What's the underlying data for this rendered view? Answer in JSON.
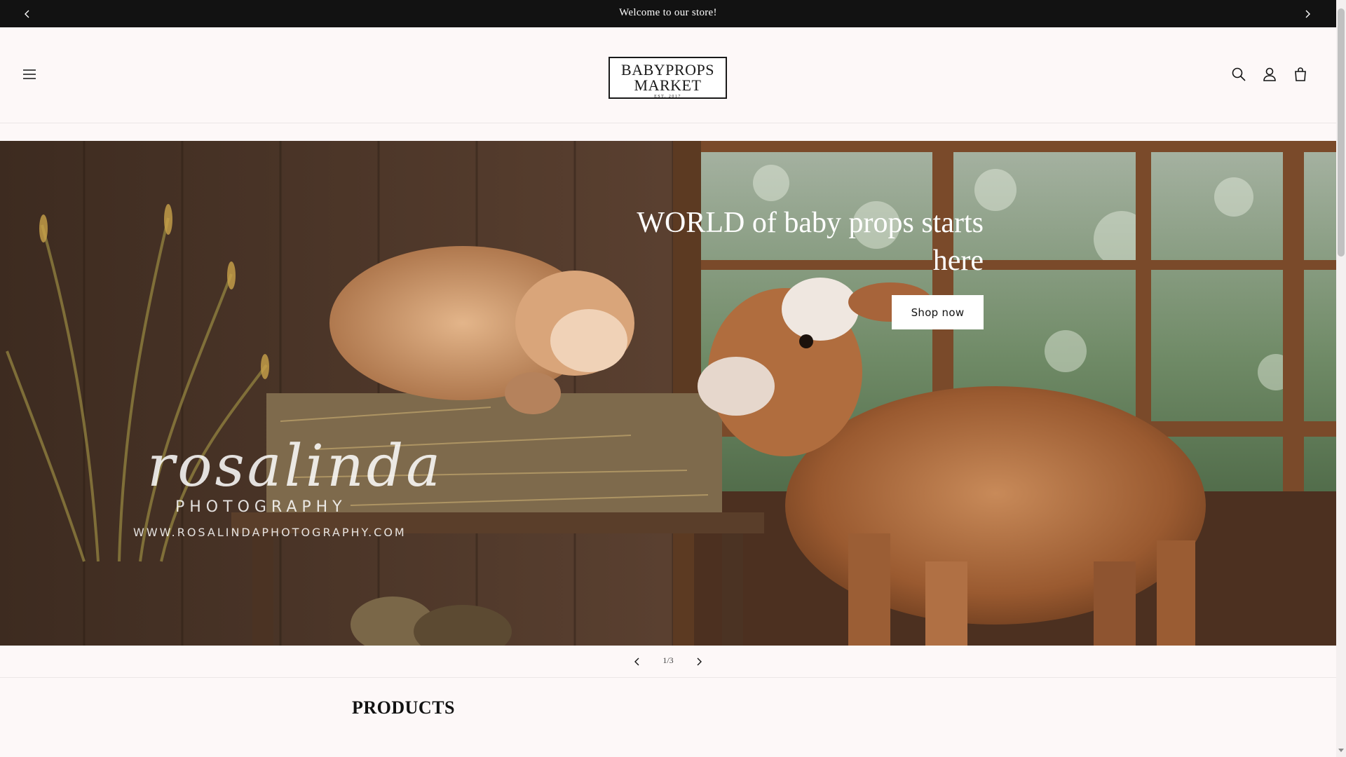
{
  "announcement": {
    "message": "Welcome to our store!",
    "prev_icon": "chevron-left-icon",
    "next_icon": "chevron-right-icon"
  },
  "header": {
    "logo": {
      "line1": "BABYPROPS",
      "line2": "MARKET",
      "line3": "EST. 2017"
    },
    "icons": [
      "menu-icon",
      "search-icon",
      "account-icon",
      "cart-icon"
    ]
  },
  "hero": {
    "heading": "WORLD of baby props starts here",
    "button_label": "Shop now",
    "watermark": {
      "name": "rosalinda",
      "sub": "PHOTOGRAPHY",
      "url": "WWW.ROSALINDAPHOTOGRAPHY.COM"
    }
  },
  "slider": {
    "counter": "1/3"
  },
  "products": {
    "title": "PRODUCTS"
  },
  "colors": {
    "announcement_bg": "#121212",
    "page_bg": "#fdf8f8",
    "button_bg": "#ffffff"
  }
}
